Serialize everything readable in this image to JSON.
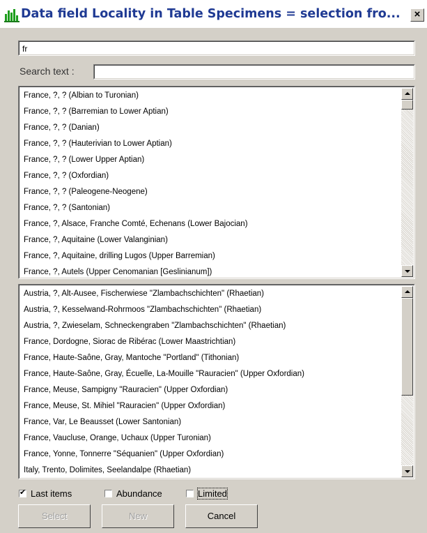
{
  "window": {
    "title": "Data field Locality in Table Specimens = selection fro...",
    "close_glyph": "×",
    "icon": "chart-bar-icon"
  },
  "filter": {
    "value": "fr"
  },
  "search": {
    "label": "Search text :",
    "value": ""
  },
  "upper_list": {
    "items": [
      "France, ?, ? (Albian to Turonian)",
      "France, ?, ? (Barremian to Lower Aptian)",
      "France, ?, ? (Danian)",
      "France, ?, ? (Hauterivian to Lower Aptian)",
      "France, ?, ? (Lower Upper Aptian)",
      "France, ?, ? (Oxfordian)",
      "France, ?, ? (Paleogene-Neogene)",
      "France, ?, ? (Santonian)",
      "France, ?, Alsace, Franche Comté, Echenans (Lower Bajocian)",
      "France, ?, Aquitaine (Lower Valanginian)",
      "France, ?, Aquitaine, drilling Lugos (Upper Barremian)",
      "France, ?, Autels (Upper Cenomanian [Geslinianum])"
    ],
    "scroll_position": 0.0
  },
  "lower_list": {
    "items": [
      "Austria, ?, Alt-Ausee, Fischerwiese \"Zlambachschichten\" (Rhaetian)",
      "Austria, ?, Kesselwand-Rohrmoos \"Zlambachschichten\" (Rhaetian)",
      "Austria, ?, Zwieselam, Schneckengraben \"Zlambachschichten\" (Rhaetian)",
      "France, Dordogne, Siorac de Ribérac (Lower Maastrichtian)",
      "France, Haute-Saône, Gray, Mantoche \"Portland\" (Tithonian)",
      "France, Haute-Saône, Gray, Écuelle, La-Mouille \"Rauracien\" (Upper Oxfordian)",
      "France, Meuse, Sampigny \"Rauracien\" (Upper Oxfordian)",
      "France, Meuse, St. Mihiel \"Rauracien\" (Upper Oxfordian)",
      "France, Var, Le Beausset (Lower Santonian)",
      "France, Vaucluse, Orange, Uchaux (Upper Turonian)",
      "France, Yonne, Tonnerre \"Séquanien\" (Upper Oxfordian)",
      "Italy, Trento, Dolimites, Seelandalpe (Rhaetian)"
    ],
    "scroll_position": 0.0
  },
  "options": {
    "last_items": {
      "label": "Last items",
      "checked": true
    },
    "abundance": {
      "label": "Abundance",
      "checked": false
    },
    "limited": {
      "label": "Limited",
      "checked": false
    }
  },
  "buttons": {
    "select": "Select",
    "new": "New",
    "cancel": "Cancel"
  },
  "colors": {
    "title_text": "#1f3a93",
    "dialog_bg": "#d4d0c8"
  }
}
